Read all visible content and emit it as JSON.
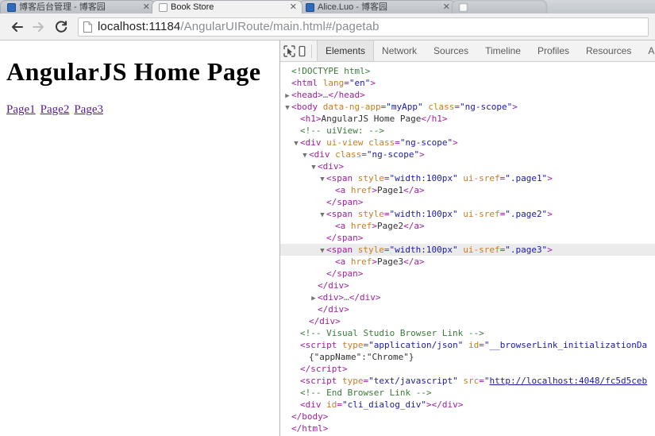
{
  "browser": {
    "tabs": [
      {
        "title": "博客后台管理 - 博客园",
        "favicon": "site-favicon-blue",
        "close": "✕",
        "active": false
      },
      {
        "title": "Book Store",
        "favicon": "blank-page-favicon",
        "close": "✕",
        "active": true
      },
      {
        "title": "Alice.Luo - 博客园",
        "favicon": "site-favicon-blue",
        "close": "✕",
        "active": false
      },
      {
        "title": "",
        "favicon": "blank-page-favicon",
        "close": "",
        "active": false
      }
    ],
    "nav": {
      "back": "back-arrow",
      "forward": "forward-arrow",
      "reload": "reload-arrow"
    },
    "omnibox": {
      "page_icon": "document-icon",
      "url_host": "localhost:11184",
      "url_path": "/AngularUIRoute/main.html#/pagetab",
      "url_full": "localhost:11184/AngularUIRoute/main.html#/pagetab"
    }
  },
  "page": {
    "heading": "AngularJS Home Page",
    "links": [
      {
        "label": "Page1"
      },
      {
        "label": "Page2"
      },
      {
        "label": "Page3"
      }
    ]
  },
  "devtools": {
    "icons": [
      {
        "name": "inspect-element-icon"
      },
      {
        "name": "device-toolbar-icon"
      }
    ],
    "tabs": [
      {
        "label": "Elements",
        "active": true
      },
      {
        "label": "Network",
        "active": false
      },
      {
        "label": "Sources",
        "active": false
      },
      {
        "label": "Timeline",
        "active": false
      },
      {
        "label": "Profiles",
        "active": false
      },
      {
        "label": "Resources",
        "active": false
      },
      {
        "label": "Audits",
        "active": false
      }
    ],
    "dom_lines": [
      {
        "indent": 0,
        "twisty": "none",
        "selected": false,
        "tokens": [
          {
            "t": "comment",
            "v": "<!DOCTYPE html>"
          }
        ]
      },
      {
        "indent": 0,
        "twisty": "none",
        "selected": false,
        "tokens": [
          {
            "t": "punct",
            "v": "<"
          },
          {
            "t": "tag",
            "v": "html"
          },
          {
            "t": "sp",
            "v": " "
          },
          {
            "t": "attr",
            "v": "lang"
          },
          {
            "t": "punct",
            "v": "="
          },
          {
            "t": "val",
            "v": "\"en\""
          },
          {
            "t": "punct",
            "v": ">"
          }
        ]
      },
      {
        "indent": 0,
        "twisty": "closed",
        "selected": false,
        "tokens": [
          {
            "t": "punct",
            "v": "<"
          },
          {
            "t": "tag",
            "v": "head"
          },
          {
            "t": "punct",
            "v": ">"
          },
          {
            "t": "dim",
            "v": "…"
          },
          {
            "t": "punct",
            "v": "</"
          },
          {
            "t": "tag",
            "v": "head"
          },
          {
            "t": "punct",
            "v": ">"
          }
        ]
      },
      {
        "indent": 0,
        "twisty": "open",
        "selected": false,
        "tokens": [
          {
            "t": "punct",
            "v": "<"
          },
          {
            "t": "tag",
            "v": "body"
          },
          {
            "t": "sp",
            "v": " "
          },
          {
            "t": "attr",
            "v": "data-ng-app"
          },
          {
            "t": "punct",
            "v": "="
          },
          {
            "t": "val",
            "v": "\"myApp\""
          },
          {
            "t": "sp",
            "v": " "
          },
          {
            "t": "attr",
            "v": "class"
          },
          {
            "t": "punct",
            "v": "="
          },
          {
            "t": "val",
            "v": "\"ng-scope\""
          },
          {
            "t": "punct",
            "v": ">"
          }
        ]
      },
      {
        "indent": 1,
        "twisty": "none",
        "selected": false,
        "tokens": [
          {
            "t": "punct",
            "v": "<"
          },
          {
            "t": "tag",
            "v": "h1"
          },
          {
            "t": "punct",
            "v": ">"
          },
          {
            "t": "text",
            "v": "AngularJS Home Page"
          },
          {
            "t": "punct",
            "v": "</"
          },
          {
            "t": "tag",
            "v": "h1"
          },
          {
            "t": "punct",
            "v": ">"
          }
        ]
      },
      {
        "indent": 1,
        "twisty": "none",
        "selected": false,
        "tokens": [
          {
            "t": "comment",
            "v": "<!-- uiView:  -->"
          }
        ]
      },
      {
        "indent": 1,
        "twisty": "open",
        "selected": false,
        "tokens": [
          {
            "t": "punct",
            "v": "<"
          },
          {
            "t": "tag",
            "v": "div"
          },
          {
            "t": "sp",
            "v": " "
          },
          {
            "t": "attr",
            "v": "ui-view"
          },
          {
            "t": "sp",
            "v": " "
          },
          {
            "t": "attr",
            "v": "class"
          },
          {
            "t": "punct",
            "v": "="
          },
          {
            "t": "val",
            "v": "\"ng-scope\""
          },
          {
            "t": "punct",
            "v": ">"
          }
        ]
      },
      {
        "indent": 2,
        "twisty": "open",
        "selected": false,
        "tokens": [
          {
            "t": "punct",
            "v": "<"
          },
          {
            "t": "tag",
            "v": "div"
          },
          {
            "t": "sp",
            "v": " "
          },
          {
            "t": "attr",
            "v": "class"
          },
          {
            "t": "punct",
            "v": "="
          },
          {
            "t": "val",
            "v": "\"ng-scope\""
          },
          {
            "t": "punct",
            "v": ">"
          }
        ]
      },
      {
        "indent": 3,
        "twisty": "open",
        "selected": false,
        "tokens": [
          {
            "t": "punct",
            "v": "<"
          },
          {
            "t": "tag",
            "v": "div"
          },
          {
            "t": "punct",
            "v": ">"
          }
        ]
      },
      {
        "indent": 4,
        "twisty": "open",
        "selected": false,
        "tokens": [
          {
            "t": "punct",
            "v": "<"
          },
          {
            "t": "tag",
            "v": "span"
          },
          {
            "t": "sp",
            "v": " "
          },
          {
            "t": "attr",
            "v": "style"
          },
          {
            "t": "punct",
            "v": "="
          },
          {
            "t": "val",
            "v": "\"width:100px\""
          },
          {
            "t": "sp",
            "v": " "
          },
          {
            "t": "attr",
            "v": "ui-sref"
          },
          {
            "t": "punct",
            "v": "="
          },
          {
            "t": "val",
            "v": "\".page1\""
          },
          {
            "t": "punct",
            "v": ">"
          }
        ]
      },
      {
        "indent": 5,
        "twisty": "none",
        "selected": false,
        "tokens": [
          {
            "t": "punct",
            "v": "<"
          },
          {
            "t": "tag",
            "v": "a"
          },
          {
            "t": "sp",
            "v": " "
          },
          {
            "t": "attr",
            "v": "href"
          },
          {
            "t": "punct",
            "v": ">"
          },
          {
            "t": "text",
            "v": "Page1"
          },
          {
            "t": "punct",
            "v": "</"
          },
          {
            "t": "tag",
            "v": "a"
          },
          {
            "t": "punct",
            "v": ">"
          }
        ]
      },
      {
        "indent": 4,
        "twisty": "none",
        "selected": false,
        "tokens": [
          {
            "t": "punct",
            "v": "</"
          },
          {
            "t": "tag",
            "v": "span"
          },
          {
            "t": "punct",
            "v": ">"
          }
        ]
      },
      {
        "indent": 4,
        "twisty": "open",
        "selected": false,
        "tokens": [
          {
            "t": "punct",
            "v": "<"
          },
          {
            "t": "tag",
            "v": "span"
          },
          {
            "t": "sp",
            "v": " "
          },
          {
            "t": "attr",
            "v": "style"
          },
          {
            "t": "punct",
            "v": "="
          },
          {
            "t": "val",
            "v": "\"width:100px\""
          },
          {
            "t": "sp",
            "v": " "
          },
          {
            "t": "attr",
            "v": "ui-sref"
          },
          {
            "t": "punct",
            "v": "="
          },
          {
            "t": "val",
            "v": "\".page2\""
          },
          {
            "t": "punct",
            "v": ">"
          }
        ]
      },
      {
        "indent": 5,
        "twisty": "none",
        "selected": false,
        "tokens": [
          {
            "t": "punct",
            "v": "<"
          },
          {
            "t": "tag",
            "v": "a"
          },
          {
            "t": "sp",
            "v": " "
          },
          {
            "t": "attr",
            "v": "href"
          },
          {
            "t": "punct",
            "v": ">"
          },
          {
            "t": "text",
            "v": "Page2"
          },
          {
            "t": "punct",
            "v": "</"
          },
          {
            "t": "tag",
            "v": "a"
          },
          {
            "t": "punct",
            "v": ">"
          }
        ]
      },
      {
        "indent": 4,
        "twisty": "none",
        "selected": false,
        "tokens": [
          {
            "t": "punct",
            "v": "</"
          },
          {
            "t": "tag",
            "v": "span"
          },
          {
            "t": "punct",
            "v": ">"
          }
        ]
      },
      {
        "indent": 4,
        "twisty": "open",
        "selected": true,
        "tokens": [
          {
            "t": "punct",
            "v": "<"
          },
          {
            "t": "tag",
            "v": "span"
          },
          {
            "t": "sp",
            "v": " "
          },
          {
            "t": "attr",
            "v": "style"
          },
          {
            "t": "punct",
            "v": "="
          },
          {
            "t": "val",
            "v": "\"width:100px\""
          },
          {
            "t": "sp",
            "v": " "
          },
          {
            "t": "attr",
            "v": "ui-sref"
          },
          {
            "t": "punct",
            "v": "="
          },
          {
            "t": "val",
            "v": "\".page3\""
          },
          {
            "t": "punct",
            "v": ">"
          }
        ]
      },
      {
        "indent": 5,
        "twisty": "none",
        "selected": false,
        "tokens": [
          {
            "t": "punct",
            "v": "<"
          },
          {
            "t": "tag",
            "v": "a"
          },
          {
            "t": "sp",
            "v": " "
          },
          {
            "t": "attr",
            "v": "href"
          },
          {
            "t": "punct",
            "v": ">"
          },
          {
            "t": "text",
            "v": "Page3"
          },
          {
            "t": "punct",
            "v": "</"
          },
          {
            "t": "tag",
            "v": "a"
          },
          {
            "t": "punct",
            "v": ">"
          }
        ]
      },
      {
        "indent": 4,
        "twisty": "none",
        "selected": false,
        "tokens": [
          {
            "t": "punct",
            "v": "</"
          },
          {
            "t": "tag",
            "v": "span"
          },
          {
            "t": "punct",
            "v": ">"
          }
        ]
      },
      {
        "indent": 3,
        "twisty": "none",
        "selected": false,
        "tokens": [
          {
            "t": "punct",
            "v": "</"
          },
          {
            "t": "tag",
            "v": "div"
          },
          {
            "t": "punct",
            "v": ">"
          }
        ]
      },
      {
        "indent": 3,
        "twisty": "closed",
        "selected": false,
        "tokens": [
          {
            "t": "punct",
            "v": "<"
          },
          {
            "t": "tag",
            "v": "div"
          },
          {
            "t": "punct",
            "v": ">"
          },
          {
            "t": "dim",
            "v": "…"
          },
          {
            "t": "punct",
            "v": "</"
          },
          {
            "t": "tag",
            "v": "div"
          },
          {
            "t": "punct",
            "v": ">"
          }
        ]
      },
      {
        "indent": 3,
        "twisty": "none",
        "selected": false,
        "tokens": [
          {
            "t": "punct",
            "v": "</"
          },
          {
            "t": "tag",
            "v": "div"
          },
          {
            "t": "punct",
            "v": ">"
          }
        ]
      },
      {
        "indent": 2,
        "twisty": "none",
        "selected": false,
        "tokens": [
          {
            "t": "punct",
            "v": "</"
          },
          {
            "t": "tag",
            "v": "div"
          },
          {
            "t": "punct",
            "v": ">"
          }
        ]
      },
      {
        "indent": 1,
        "twisty": "none",
        "selected": false,
        "tokens": [
          {
            "t": "comment",
            "v": "<!-- Visual Studio Browser Link -->"
          }
        ]
      },
      {
        "indent": 1,
        "twisty": "none",
        "selected": false,
        "tokens": [
          {
            "t": "punct",
            "v": "<"
          },
          {
            "t": "tag",
            "v": "script"
          },
          {
            "t": "sp",
            "v": " "
          },
          {
            "t": "attr",
            "v": "type"
          },
          {
            "t": "punct",
            "v": "="
          },
          {
            "t": "val",
            "v": "\"application/json\""
          },
          {
            "t": "sp",
            "v": " "
          },
          {
            "t": "attr",
            "v": "id"
          },
          {
            "t": "punct",
            "v": "="
          },
          {
            "t": "val",
            "v": "\"__browserLink_initializationDa"
          }
        ]
      },
      {
        "indent": 2,
        "twisty": "none",
        "selected": false,
        "tokens": [
          {
            "t": "text",
            "v": "{\"appName\":\"Chrome\"}"
          }
        ]
      },
      {
        "indent": 1,
        "twisty": "none",
        "selected": false,
        "tokens": [
          {
            "t": "punct",
            "v": "</"
          },
          {
            "t": "tag",
            "v": "script"
          },
          {
            "t": "punct",
            "v": ">"
          }
        ]
      },
      {
        "indent": 1,
        "twisty": "none",
        "selected": false,
        "tokens": [
          {
            "t": "punct",
            "v": "<"
          },
          {
            "t": "tag",
            "v": "script"
          },
          {
            "t": "sp",
            "v": " "
          },
          {
            "t": "attr",
            "v": "type"
          },
          {
            "t": "punct",
            "v": "="
          },
          {
            "t": "val",
            "v": "\"text/javascript\""
          },
          {
            "t": "sp",
            "v": " "
          },
          {
            "t": "attr",
            "v": "src"
          },
          {
            "t": "punct",
            "v": "="
          },
          {
            "t": "val",
            "v": "\""
          },
          {
            "t": "link",
            "v": "http://localhost:4048/fc5d5ceb"
          }
        ]
      },
      {
        "indent": 1,
        "twisty": "none",
        "selected": false,
        "tokens": [
          {
            "t": "comment",
            "v": "<!-- End Browser Link -->"
          }
        ]
      },
      {
        "indent": 1,
        "twisty": "none",
        "selected": false,
        "tokens": [
          {
            "t": "punct",
            "v": "<"
          },
          {
            "t": "tag",
            "v": "div"
          },
          {
            "t": "sp",
            "v": " "
          },
          {
            "t": "attr",
            "v": "id"
          },
          {
            "t": "punct",
            "v": "="
          },
          {
            "t": "val",
            "v": "\"cli_dialog_div\""
          },
          {
            "t": "punct",
            "v": ">"
          },
          {
            "t": "punct",
            "v": "</"
          },
          {
            "t": "tag",
            "v": "div"
          },
          {
            "t": "punct",
            "v": ">"
          }
        ]
      },
      {
        "indent": 0,
        "twisty": "none",
        "selected": false,
        "tokens": [
          {
            "t": "punct",
            "v": "</"
          },
          {
            "t": "tag",
            "v": "body"
          },
          {
            "t": "punct",
            "v": ">"
          }
        ]
      },
      {
        "indent": -1,
        "twisty": "none",
        "selected": false,
        "tokens": [
          {
            "t": "punct",
            "v": "</"
          },
          {
            "t": "tag",
            "v": "html"
          },
          {
            "t": "punct",
            "v": ">"
          }
        ]
      }
    ]
  }
}
